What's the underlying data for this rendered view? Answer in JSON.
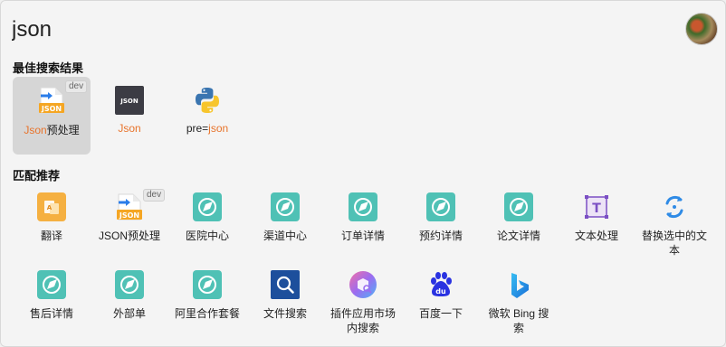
{
  "search": {
    "query": "json"
  },
  "sections": {
    "best_title": "最佳搜索结果",
    "match_title": "匹配推荐"
  },
  "best": [
    {
      "pre": "",
      "hl": "Json",
      "post": "预处理",
      "icon": "json-file-arrow-icon",
      "badge": "dev",
      "selected": true
    },
    {
      "pre": "",
      "hl": "Json",
      "post": "",
      "icon": "json-dark-tile-icon",
      "badge": "",
      "selected": false
    },
    {
      "pre": "pre=",
      "hl": "json",
      "post": "",
      "icon": "python-icon",
      "badge": "",
      "selected": false
    }
  ],
  "matches": [
    {
      "label": "翻译",
      "icon": "translate-icon"
    },
    {
      "label": "JSON预处理",
      "icon": "json-file-arrow-icon",
      "badge": "dev"
    },
    {
      "label": "医院中心",
      "icon": "compass-globe-icon"
    },
    {
      "label": "渠道中心",
      "icon": "compass-globe-icon"
    },
    {
      "label": "订单详情",
      "icon": "compass-globe-icon"
    },
    {
      "label": "预约详情",
      "icon": "compass-globe-icon"
    },
    {
      "label": "论文详情",
      "icon": "compass-globe-icon"
    },
    {
      "label": "文本处理",
      "icon": "text-t-icon"
    },
    {
      "label": "替换选中的文本",
      "icon": "refresh-q-icon"
    },
    {
      "label": "售后详情",
      "icon": "compass-globe-icon"
    },
    {
      "label": "外部单",
      "icon": "compass-globe-icon"
    },
    {
      "label": "阿里合作套餐",
      "icon": "compass-globe-icon"
    },
    {
      "label": "文件搜索",
      "icon": "file-search-icon"
    },
    {
      "label": "插件应用市场内搜索",
      "icon": "plugin-market-search-icon"
    },
    {
      "label": "百度一下",
      "icon": "baidu-paw-icon"
    },
    {
      "label": "微软 Bing 搜索",
      "icon": "bing-icon"
    }
  ],
  "colors": {
    "accent": "#e8742c",
    "teal": "#4fc1b5",
    "selected_bg": "#d6d6d6"
  }
}
